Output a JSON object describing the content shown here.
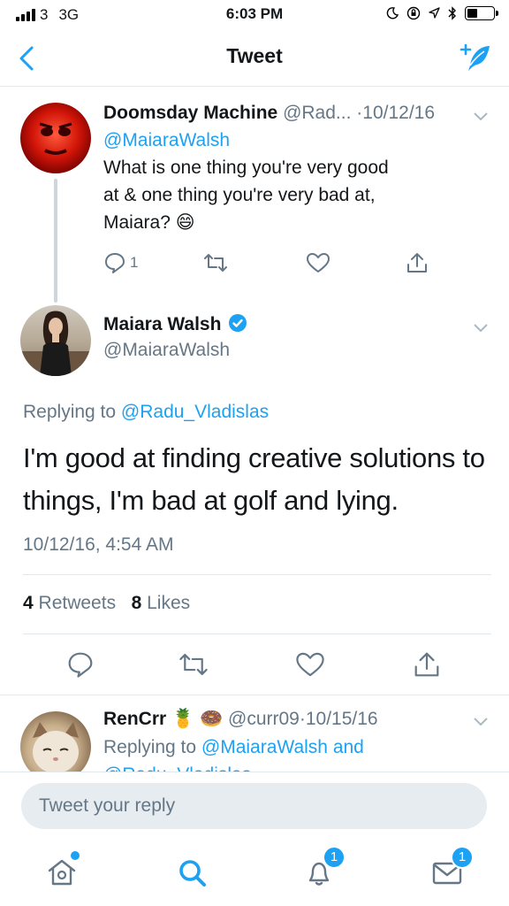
{
  "status_bar": {
    "carrier": "3",
    "network": "3G",
    "time": "6:03 PM"
  },
  "nav": {
    "title": "Tweet"
  },
  "parent_tweet": {
    "name": "Doomsday Machine",
    "handle": "@Rad...",
    "separator": "·",
    "date": "10/12/16",
    "mention": "@MaiaraWalsh",
    "text_line1": "What is one thing you're very good",
    "text_line2": "at & one thing you're very bad at,",
    "text_line3": "Maiara? 😄",
    "reply_count": "1"
  },
  "main_tweet": {
    "name": "Maiara Walsh",
    "handle": "@MaiaraWalsh",
    "replying_prefix": "Replying to",
    "replying_to": "@Radu_Vladislas",
    "text": "I'm good at finding creative solutions to things, I'm bad at golf and lying.",
    "timestamp": "10/12/16, 4:54 AM",
    "retweets_count": "4",
    "retweets_label": "Retweets",
    "likes_count": "8",
    "likes_label": "Likes"
  },
  "reply_tweet": {
    "name": "RenCrr",
    "emoji": "🍍 🍩",
    "handle": "@curr09",
    "separator": "·",
    "date": "10/15/16",
    "replying_prefix": "Replying to",
    "replying_to": "@MaiaraWalsh and",
    "replying_to_2": "@Radu_Vladislas"
  },
  "composer": {
    "placeholder": "Tweet your reply"
  },
  "tab_bar": {
    "notifications_badge": "1",
    "messages_badge": "1"
  },
  "colors": {
    "accent": "#1da1f2",
    "secondary_text": "#657786",
    "divider": "#e1e8ed"
  }
}
